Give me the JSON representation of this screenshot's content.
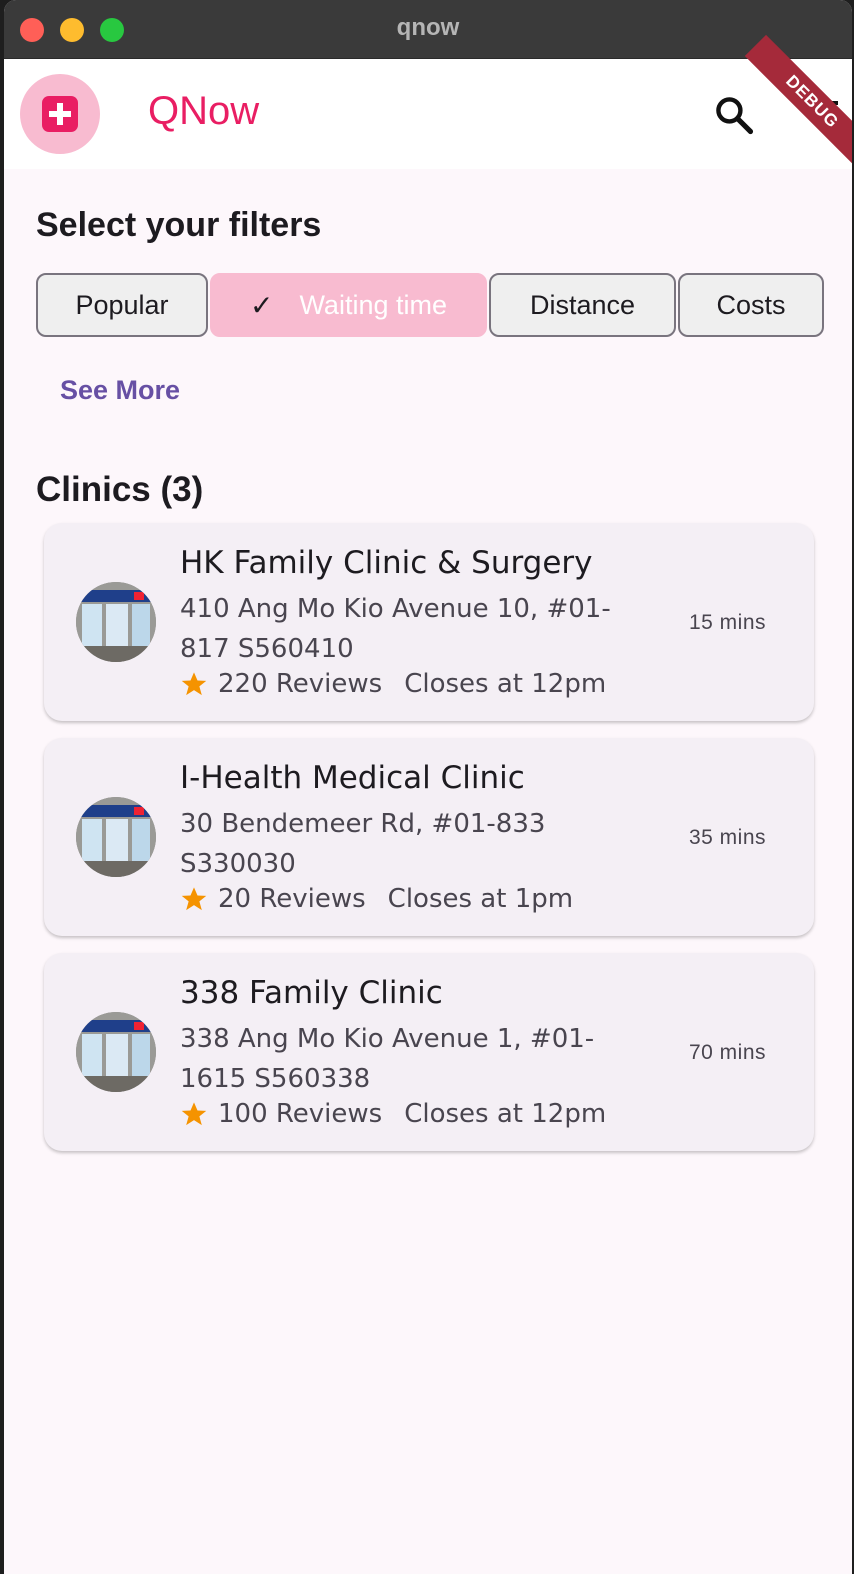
{
  "window": {
    "title": "qnow"
  },
  "appbar": {
    "title": "QNow",
    "debug_banner": "DEBUG",
    "icons": [
      "logo-icon",
      "search-icon",
      "filter-menu-icon"
    ]
  },
  "filters": {
    "title": "Select your filters",
    "chips": [
      {
        "label": "Popular",
        "selected": false
      },
      {
        "label": "Waiting time",
        "selected": true
      },
      {
        "label": "Distance",
        "selected": false
      },
      {
        "label": "Costs",
        "selected": false
      }
    ],
    "see_more": "See More"
  },
  "clinics": {
    "title": "Clinics (3)",
    "items": [
      {
        "name": "HK Family Clinic & Surgery",
        "address": "410 Ang Mo Kio Avenue 10, #01-817 S560410",
        "reviews": "220 Reviews",
        "closes": "Closes at 12pm",
        "wait": "15 mins"
      },
      {
        "name": "I-Health Medical Clinic",
        "address": "30 Bendemeer Rd, #01-833 S330030",
        "reviews": "20 Reviews",
        "closes": "Closes at 1pm",
        "wait": "35 mins"
      },
      {
        "name": "338 Family Clinic",
        "address": "338 Ang Mo Kio Avenue 1, #01-1615 S560338",
        "reviews": "100 Reviews",
        "closes": "Closes at 12pm",
        "wait": "70 mins"
      }
    ]
  },
  "colors": {
    "brand": "#e91e63",
    "selected_chip": "#f8bbd0",
    "link": "#6750a4",
    "star": "#f59300",
    "card": "#f4eff5"
  }
}
